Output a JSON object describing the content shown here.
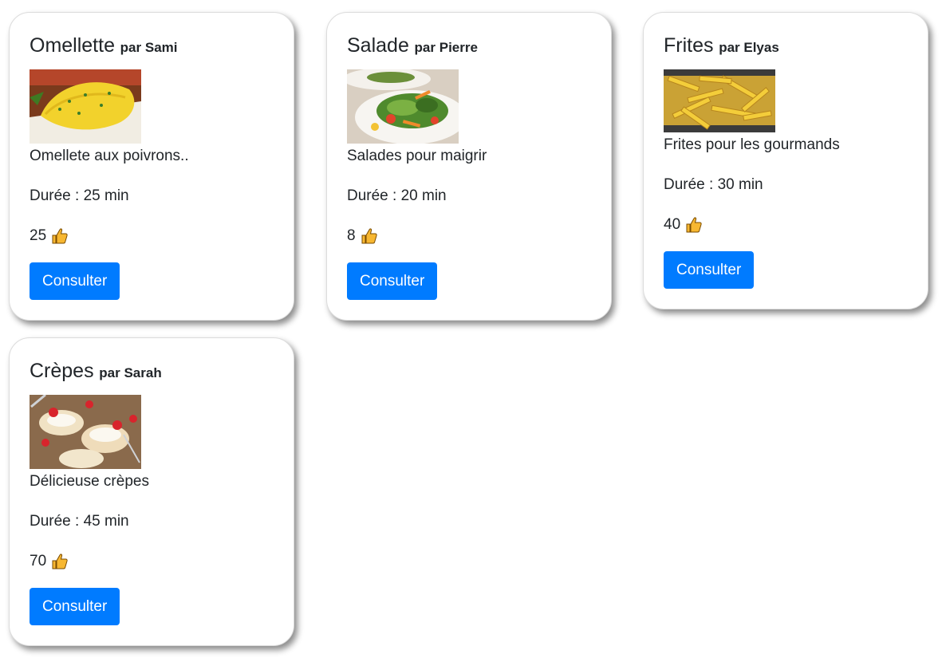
{
  "accent_color": "#007bff",
  "like_icon": "thumbs-up-icon",
  "recipes": [
    {
      "name": "Omellette",
      "author": "par Sami",
      "description": "Omellete aux poivrons..",
      "duration": "Durée : 25 min",
      "likes": "25",
      "button_label": "Consulter",
      "image": "omelette-photo"
    },
    {
      "name": "Salade",
      "author": "par Pierre",
      "description": "Salades pour maigrir",
      "duration": "Durée : 20 min",
      "likes": "8",
      "button_label": "Consulter",
      "image": "salad-photo"
    },
    {
      "name": "Frites",
      "author": "par Elyas",
      "description": "Frites pour les gourmands",
      "duration": "Durée : 30 min",
      "likes": "40",
      "button_label": "Consulter",
      "image": "fries-photo"
    },
    {
      "name": "Crèpes",
      "author": "par Sarah",
      "description": "Délicieuse crèpes",
      "duration": "Durée : 45 min",
      "likes": "70",
      "button_label": "Consulter",
      "image": "crepes-photo"
    }
  ]
}
